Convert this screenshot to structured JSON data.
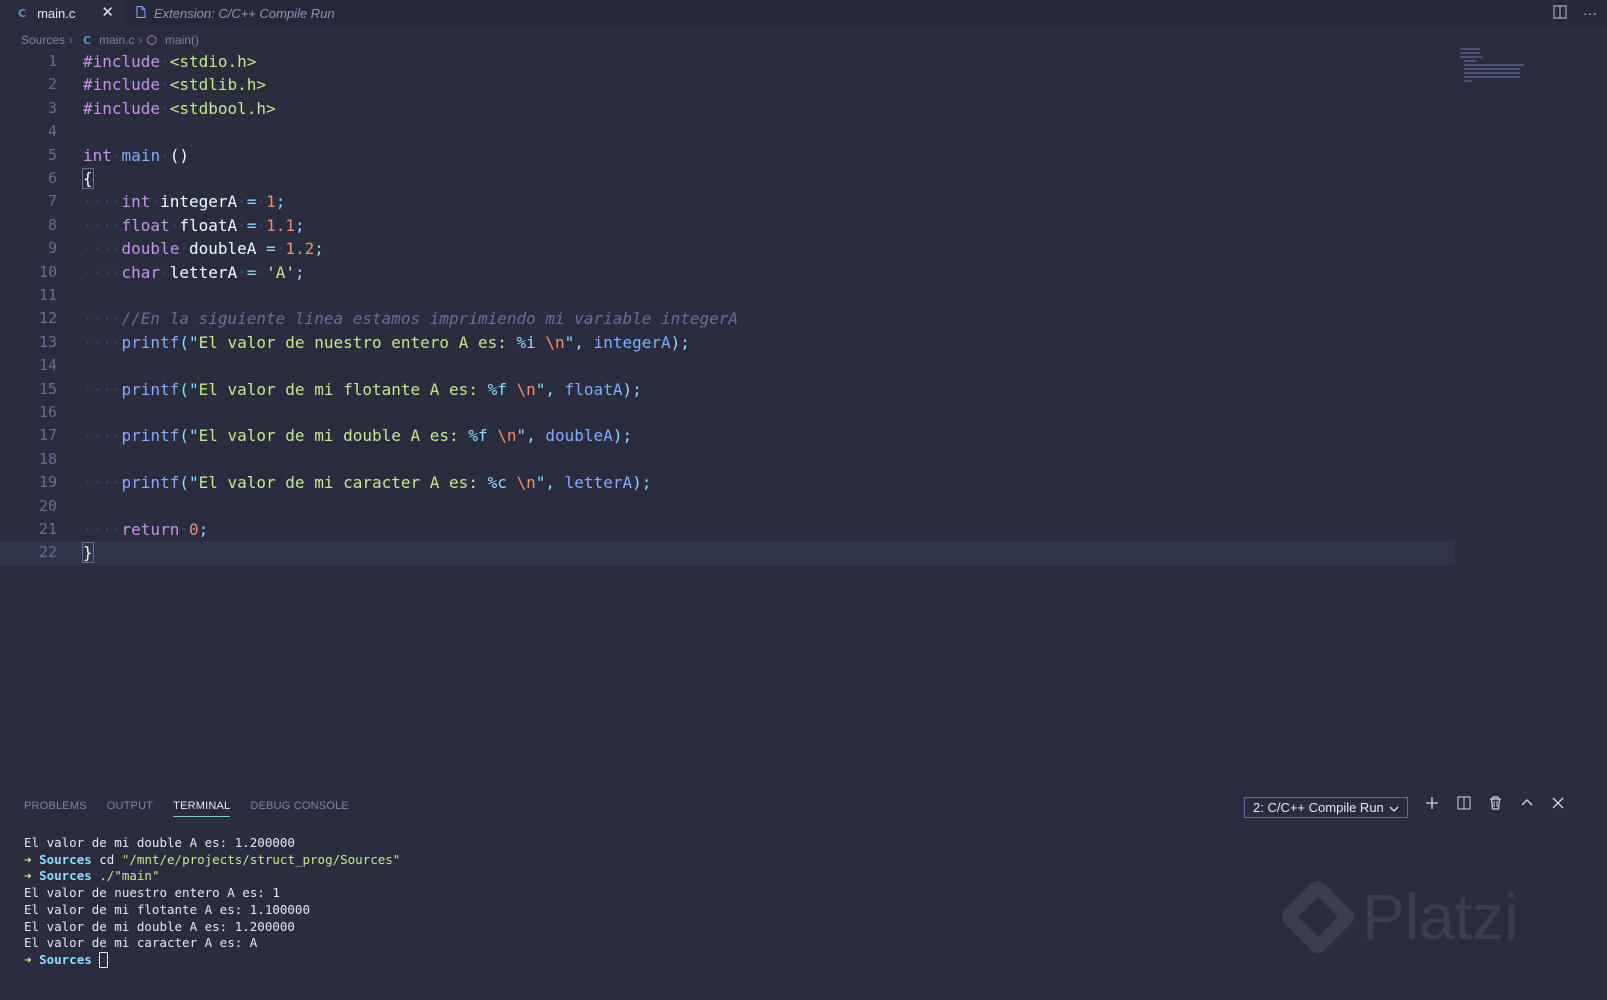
{
  "tabs": [
    {
      "label": "main.c",
      "icon": "C",
      "close": "✕"
    },
    {
      "label": "Extension: C/C++ Compile Run",
      "icon": "file-icon"
    }
  ],
  "breadcrumb": {
    "folder": "Sources",
    "file": "main.c",
    "symbol": "main()"
  },
  "editor_lines": [
    {
      "n": "1"
    },
    {
      "n": "2"
    },
    {
      "n": "3"
    },
    {
      "n": "4"
    },
    {
      "n": "5"
    },
    {
      "n": "6"
    },
    {
      "n": "7"
    },
    {
      "n": "8"
    },
    {
      "n": "9"
    },
    {
      "n": "10"
    },
    {
      "n": "11"
    },
    {
      "n": "12"
    },
    {
      "n": "13"
    },
    {
      "n": "14"
    },
    {
      "n": "15"
    },
    {
      "n": "16"
    },
    {
      "n": "17"
    },
    {
      "n": "18"
    },
    {
      "n": "19"
    },
    {
      "n": "20"
    },
    {
      "n": "21"
    },
    {
      "n": "22"
    }
  ],
  "code": {
    "l1": [
      "#include",
      "<stdio.h>"
    ],
    "l2": [
      "#include",
      "<stdlib.h>"
    ],
    "l3": [
      "#include",
      "<stdbool.h>"
    ],
    "l5": [
      "int",
      "main",
      "()"
    ],
    "l6": "{",
    "l7": [
      "int",
      "integerA",
      "=",
      "1",
      ";"
    ],
    "l8": [
      "float",
      "floatA",
      "=",
      "1.1",
      ";"
    ],
    "l9": [
      "double",
      "doubleA",
      "=",
      "1.2",
      ";"
    ],
    "l10": [
      "char",
      "letterA",
      "=",
      "'A'",
      ";"
    ],
    "l12": "//En la siguiente linea estamos imprimiendo mi variable integerA",
    "l13": [
      "printf",
      "(\"",
      "El valor de nuestro entero A es: ",
      "%i",
      " ",
      "\\n",
      "\"",
      ", ",
      "integerA",
      ");"
    ],
    "l15": [
      "printf",
      "(\"",
      "El valor de mi flotante A es: ",
      "%f",
      " ",
      "\\n",
      "\"",
      ", ",
      "floatA",
      ");"
    ],
    "l17": [
      "printf",
      "(\"",
      "El valor de mi double A es: ",
      "%f",
      " ",
      "\\n",
      "\"",
      ", ",
      "doubleA",
      ");"
    ],
    "l19": [
      "printf",
      "(\"",
      "El valor de mi caracter A es: ",
      "%c",
      " ",
      "\\n",
      "\"",
      ", ",
      "letterA",
      ");"
    ],
    "l21": [
      "return",
      "0",
      ";"
    ],
    "l22": "}"
  },
  "panel": {
    "tabs": [
      "PROBLEMS",
      "OUTPUT",
      "TERMINAL",
      "DEBUG CONSOLE"
    ],
    "active_tab": "TERMINAL",
    "terminal_select": "2: C/C++ Compile Run"
  },
  "terminal": {
    "line1": "El valor de mi double A es: 1.200000",
    "prompt_arrow": "➜",
    "prompt_dir": "Sources",
    "cmd1": "cd",
    "cmd1_arg": "\"/mnt/e/projects/struct_prog/Sources\"",
    "cmd2": "./\"main\"",
    "out1": "El valor de nuestro entero A es: 1",
    "out2": "El valor de mi flotante A es: 1.100000",
    "out3": "El valor de mi double A es: 1.200000",
    "out4": "El valor de mi caracter A es: A"
  },
  "watermark": "Platzi"
}
